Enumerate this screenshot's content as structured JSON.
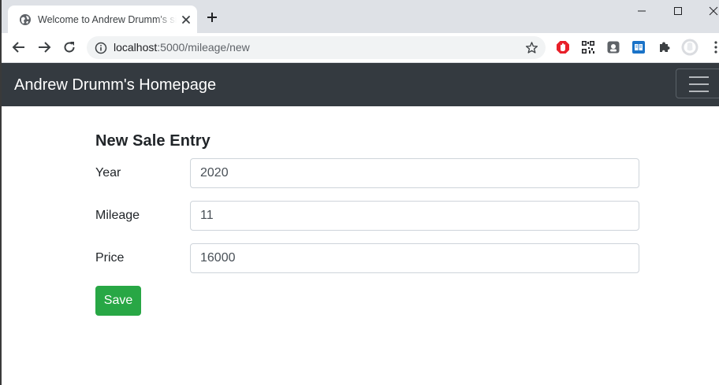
{
  "browser": {
    "tab": {
      "title": "Welcome to Andrew Drumm's site",
      "favicon": "globe-icon"
    },
    "address_bar": {
      "host": "localhost",
      "rest": ":5000/mileage/new"
    },
    "extensions": [
      "adblock-icon",
      "qr-code-icon",
      "extension-square-icon",
      "reader-icon",
      "puzzle-icon",
      "profile-icon"
    ]
  },
  "navbar": {
    "brand": "Andrew Drumm's Homepage",
    "bg_color": "#343a40"
  },
  "form": {
    "title": "New Sale Entry",
    "fields": [
      {
        "label": "Year",
        "value": "2020"
      },
      {
        "label": "Mileage",
        "value": "11"
      },
      {
        "label": "Price",
        "value": "16000"
      }
    ],
    "save_label": "Save",
    "save_color": "#28a745"
  }
}
